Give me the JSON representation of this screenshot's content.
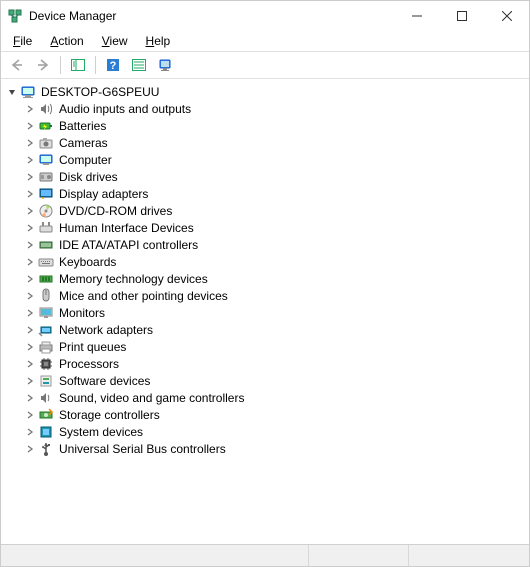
{
  "window": {
    "title": "Device Manager"
  },
  "menu": {
    "items": [
      {
        "label": "File",
        "accel": "F"
      },
      {
        "label": "Action",
        "accel": "A"
      },
      {
        "label": "View",
        "accel": "V"
      },
      {
        "label": "Help",
        "accel": "H"
      }
    ]
  },
  "toolbar": {
    "buttons": [
      {
        "name": "back",
        "enabled": false
      },
      {
        "name": "forward",
        "enabled": false
      },
      {
        "name": "show-hide-tree",
        "enabled": true
      },
      {
        "name": "help",
        "enabled": true
      },
      {
        "name": "properties",
        "enabled": true
      },
      {
        "name": "scan-hardware",
        "enabled": true
      }
    ]
  },
  "tree": {
    "root": {
      "label": "DESKTOP-G6SPEUU",
      "expanded": true
    },
    "categories": [
      {
        "label": "Audio inputs and outputs",
        "icon": "speaker"
      },
      {
        "label": "Batteries",
        "icon": "battery"
      },
      {
        "label": "Cameras",
        "icon": "camera"
      },
      {
        "label": "Computer",
        "icon": "computer"
      },
      {
        "label": "Disk drives",
        "icon": "disk"
      },
      {
        "label": "Display adapters",
        "icon": "display"
      },
      {
        "label": "DVD/CD-ROM drives",
        "icon": "cdrom"
      },
      {
        "label": "Human Interface Devices",
        "icon": "hid"
      },
      {
        "label": "IDE ATA/ATAPI controllers",
        "icon": "ide"
      },
      {
        "label": "Keyboards",
        "icon": "keyboard"
      },
      {
        "label": "Memory technology devices",
        "icon": "memory"
      },
      {
        "label": "Mice and other pointing devices",
        "icon": "mouse"
      },
      {
        "label": "Monitors",
        "icon": "monitor"
      },
      {
        "label": "Network adapters",
        "icon": "network"
      },
      {
        "label": "Print queues",
        "icon": "printer"
      },
      {
        "label": "Processors",
        "icon": "cpu"
      },
      {
        "label": "Software devices",
        "icon": "software"
      },
      {
        "label": "Sound, video and game controllers",
        "icon": "sound"
      },
      {
        "label": "Storage controllers",
        "icon": "storage"
      },
      {
        "label": "System devices",
        "icon": "system"
      },
      {
        "label": "Universal Serial Bus controllers",
        "icon": "usb"
      }
    ]
  }
}
